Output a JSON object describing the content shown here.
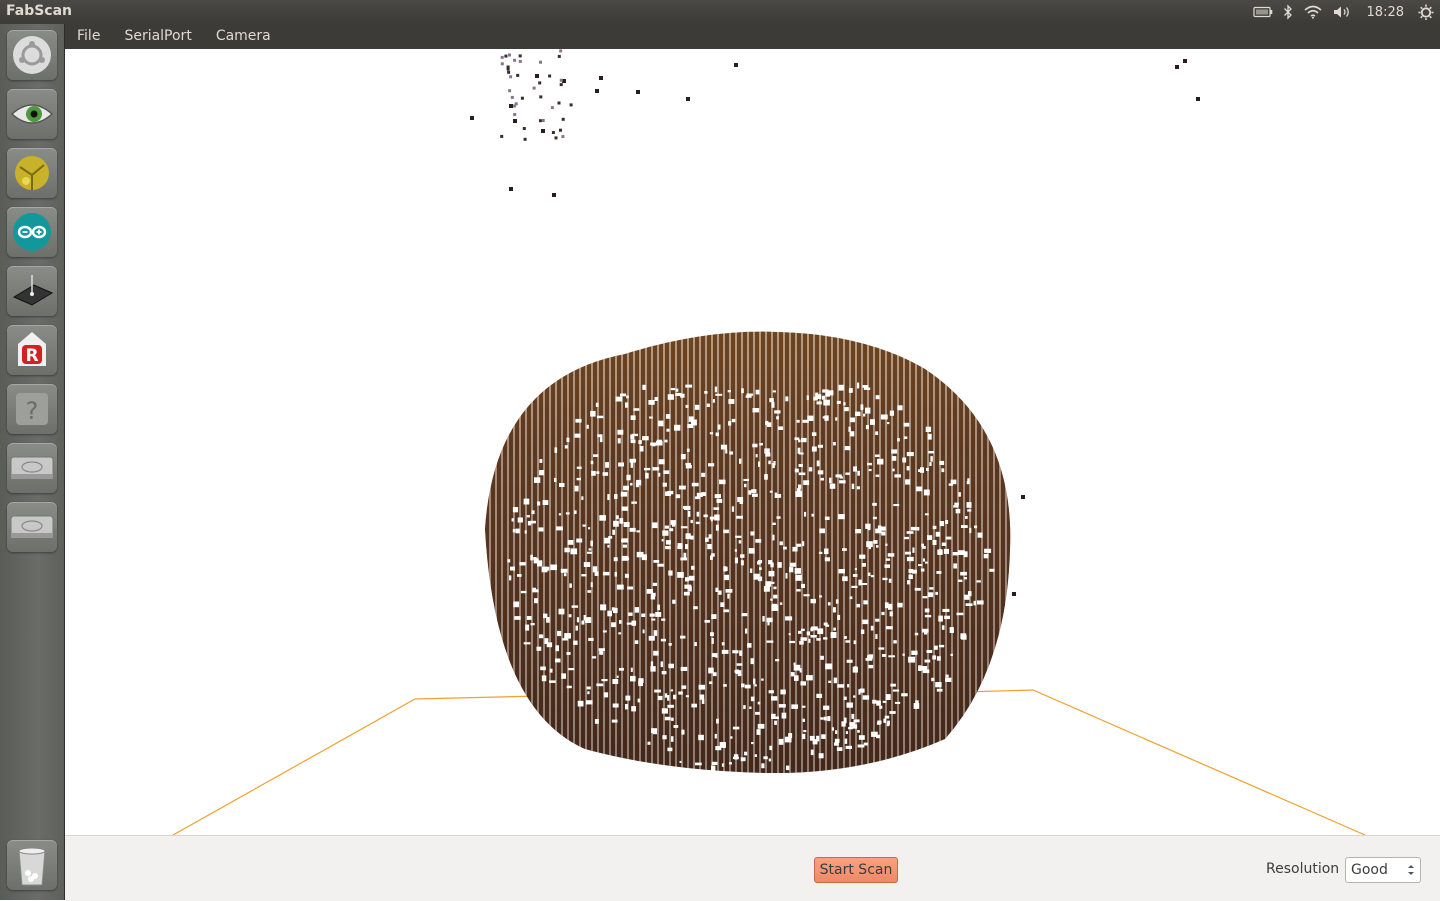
{
  "app": {
    "title": "FabScan"
  },
  "panel": {
    "clock": "18:28",
    "indicators": [
      "battery-icon",
      "bluetooth-icon",
      "wifi-icon",
      "volume-icon",
      "power-icon"
    ]
  },
  "menu": {
    "items": [
      {
        "label": "File"
      },
      {
        "label": "SerialPort"
      },
      {
        "label": "Camera"
      }
    ]
  },
  "launcher": {
    "items": [
      {
        "name": "ubuntu-dash-icon"
      },
      {
        "name": "eye-app-icon"
      },
      {
        "name": "3d-viewer-icon"
      },
      {
        "name": "arduino-icon"
      },
      {
        "name": "scanner-device-icon"
      },
      {
        "name": "r-app-icon"
      },
      {
        "name": "help-icon"
      },
      {
        "name": "drive-icon"
      },
      {
        "name": "drive-icon"
      },
      {
        "name": "trash-icon"
      }
    ]
  },
  "controls": {
    "start_scan_label": "Start Scan",
    "resolution_label": "Resolution",
    "resolution_value": "Good"
  },
  "colors": {
    "panel_bg": "#3c3b37",
    "point_cloud": "#4a2a18",
    "platform_line": "#f0a030",
    "start_scan_button": "#f29270"
  }
}
